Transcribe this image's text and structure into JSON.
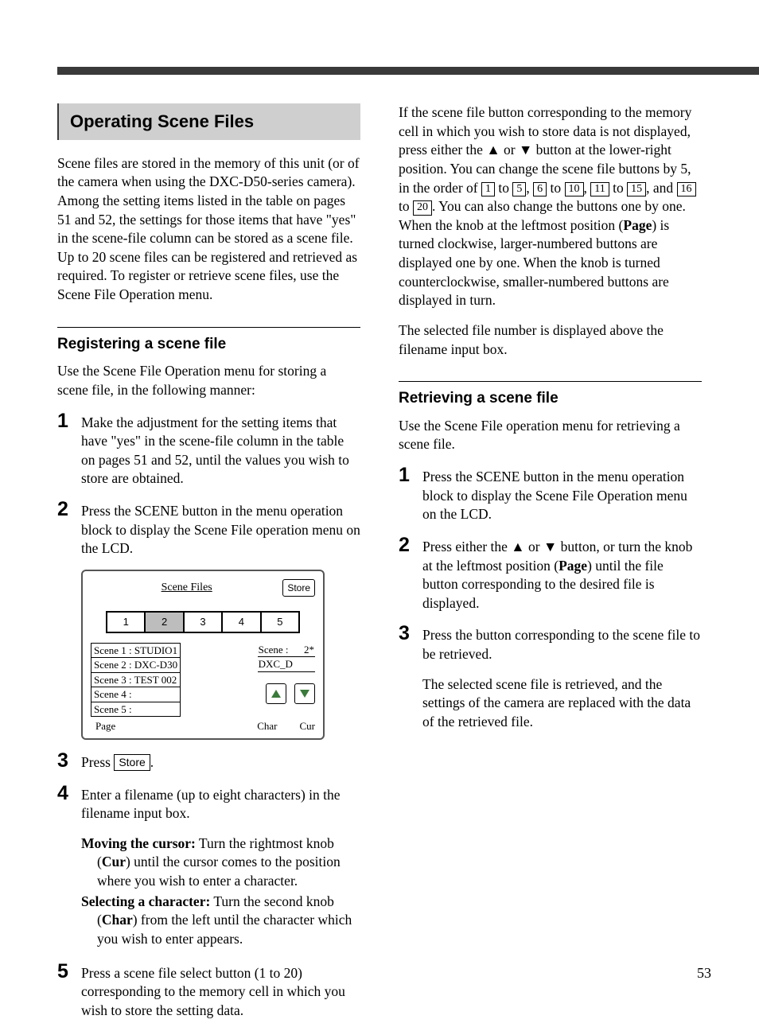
{
  "header_title": "Operating Scene Files",
  "intro": "Scene files are stored in the memory of this unit (or of the camera when using the DXC-D50-series camera). Among the setting items listed in the table on pages 51 and 52, the settings for those items that have \"yes\" in the scene-file column can be stored as a scene file. Up to 20 scene files can be registered and retrieved as required. To register or retrieve scene files, use the Scene File Operation menu.",
  "reg": {
    "heading": "Registering a scene file",
    "lead": "Use the Scene File Operation menu for storing a scene file, in the following manner:",
    "steps": {
      "s1": "Make the adjustment for the setting items that have \"yes\" in the scene-file column in the table on pages 51 and 52, until the values you wish to store are obtained.",
      "s2": "Press the SCENE button in the menu operation block to display the Scene File operation menu on the LCD.",
      "s3_pre": "Press ",
      "s3_btn": "Store",
      "s3_post": ".",
      "s4": "Enter a filename (up to eight characters) in the filename input box.",
      "s4_note_a_label": "Moving the cursor:",
      "s4_note_a_body": " Turn the rightmost knob (",
      "s4_note_a_body2": ") until the cursor comes to the position where you wish to enter a character.",
      "s4_note_b_label": "Selecting a character:",
      "s4_note_b_body": " Turn the second knob (",
      "s4_note_b_body2": ") from the left until the character which you wish to enter appears.",
      "s4_cur": "Cur",
      "s4_char": "Char",
      "s5": "Press a scene file select button (1 to 20) corresponding to the memory cell in which you wish to store the setting data."
    }
  },
  "panel": {
    "title": "Scene Files",
    "store": "Store",
    "tabs": [
      "1",
      "2",
      "3",
      "4",
      "5"
    ],
    "scenes": [
      "Scene 1 : STUDIO1",
      "Scene 2 : DXC-D30",
      "Scene 3 : TEST 002",
      "Scene 4 :",
      "Scene 5 :"
    ],
    "scene_label": "Scene :",
    "scene_val": "2*",
    "input_val": "DXC_D",
    "page": "Page",
    "char": "Char",
    "cur": "Cur"
  },
  "right": {
    "para1_a": "If the scene file button corresponding to the memory cell in which you wish to store data is not displayed, press either the ",
    "para1_b": " or ",
    "para1_c": " button at the lower-right position. You can change the scene file buttons by 5, in the order of ",
    "para1_d": " to ",
    "para1_e": ", ",
    "para1_f": " to ",
    "para1_g": ", ",
    "para1_h": " to ",
    "para1_i": ", and ",
    "para1_j": " to ",
    "para1_k": ".  You can also change the buttons one by one. When the knob at the leftmost position (",
    "page_word": "Page",
    "para1_l": ") is turned clockwise, larger-numbered buttons are displayed one by one. When the knob is turned counterclockwise, smaller-numbered buttons are displayed in turn.",
    "b1": "1",
    "b5": "5",
    "b6": "6",
    "b10": "10",
    "b11": "11",
    "b15": "15",
    "b16": "16",
    "b20": "20",
    "para2": "The selected file number is displayed above the filename input box."
  },
  "ret": {
    "heading": "Retrieving a scene file",
    "lead": "Use the Scene File operation menu for retrieving a scene file.",
    "s1": "Press the SCENE button in the menu operation block to display the Scene File Operation menu on the LCD.",
    "s2_a": "Press either the ",
    "s2_b": " or ",
    "s2_c": " button, or turn the knob at the leftmost position (",
    "s2_d": ") until the file button corresponding to the desired file is displayed.",
    "page_word": "Page",
    "s3": "Press the button corresponding to the scene file to be retrieved.",
    "tail": "The selected scene file is retrieved, and the settings of the camera are replaced with the data of the retrieved file."
  },
  "page_number": "53"
}
